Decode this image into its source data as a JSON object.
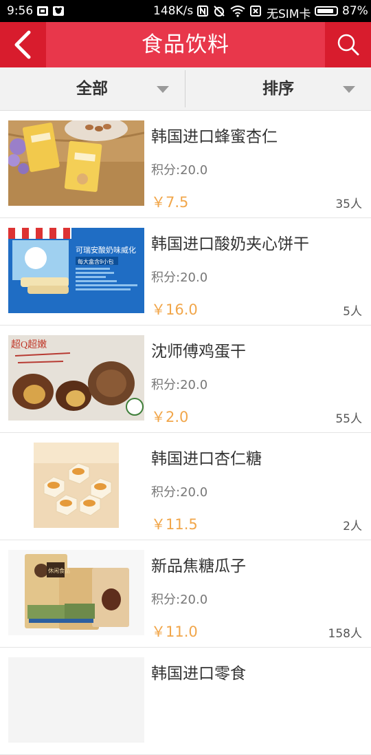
{
  "status_bar": {
    "time": "9:56",
    "speed": "148K/s",
    "sim": "无SIM卡",
    "battery": "87%",
    "battery_level": 0.87
  },
  "header": {
    "title": "食品饮料",
    "back_icon": "chevron-left-icon",
    "search_icon": "search-icon",
    "color": "#e8374b",
    "button_color": "#d81c2d"
  },
  "filters": {
    "all_label": "全部",
    "sort_label": "排序"
  },
  "products": [
    {
      "name": "韩国进口蜂蜜杏仁",
      "points": "积分:20.0",
      "price": "￥7.5",
      "count": "35人"
    },
    {
      "name": "韩国进口酸奶夹心饼干",
      "points": "积分:20.0",
      "price": "￥16.0",
      "count": "5人"
    },
    {
      "name": "沈师傅鸡蛋干",
      "points": "积分:20.0",
      "price": "￥2.0",
      "count": "55人"
    },
    {
      "name": "韩国进口杏仁糖",
      "points": "积分:20.0",
      "price": "￥11.5",
      "count": "2人"
    },
    {
      "name": "新品焦糖瓜子",
      "points": "积分:20.0",
      "price": "￥11.0",
      "count": "158人"
    },
    {
      "name": "韩国进口零食",
      "points": "",
      "price": "",
      "count": ""
    }
  ],
  "thumbnails": {
    "p2_title": "可瑞安酸奶味威化",
    "p2_sub": "每大盒含9小包",
    "p3_caption": "超Q超嫩",
    "p5_brand": "休闲食品"
  },
  "colors": {
    "price": "#f1a64a",
    "divider": "#e4e4e4"
  }
}
